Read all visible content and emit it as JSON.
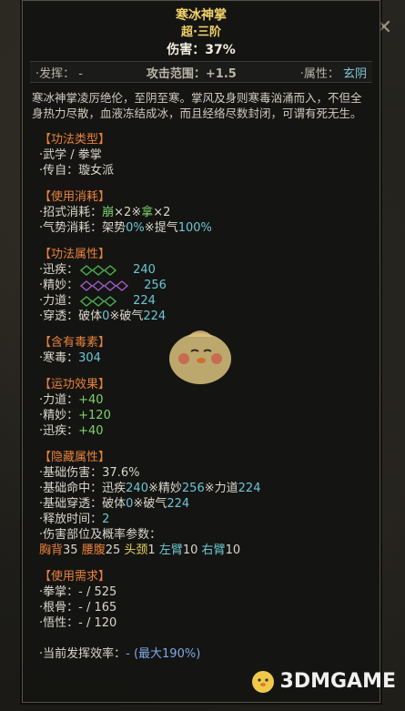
{
  "skill": {
    "name": "寒冰神掌",
    "tier": "超·三阶",
    "damage": "伤害：37%"
  },
  "meta": {
    "launch_label": "·发挥：",
    "launch_value": "-",
    "range_label": "攻击范围：",
    "range_value": "+1.5",
    "attr_label": "·属性：",
    "attr_value": "玄阴"
  },
  "description": "寒冰神掌凌厉绝伦，至阴至寒。掌风及身则寒毒汹涌而入，不但全身热力尽散，血液冻结成冰，而且经络尽数封闭，可谓有死无生。",
  "type_section": {
    "title": "【功法类型】",
    "lines": [
      "·武学 / 拳掌",
      "·传自：璇女派"
    ]
  },
  "cost_section": {
    "title": "【使用消耗】",
    "line1": {
      "label": "·招式消耗：",
      "a": "崩",
      "a_mult": "×2※",
      "b": "拿",
      "b_mult": "×2"
    },
    "line2": {
      "label": "·气势消耗：",
      "a": "架势",
      "a_val": "0%",
      "sep": "※",
      "b": "提气",
      "b_val": "100%"
    }
  },
  "attr_section": {
    "title": "【功法属性】",
    "speed": {
      "label": "·迅疾：",
      "value": "240"
    },
    "skill": {
      "label": "·精妙：",
      "value": "256"
    },
    "power": {
      "label": "·力道：",
      "value": "224"
    },
    "pierce": {
      "label": "·穿透：",
      "a": "破体",
      "a_val": "0",
      "sep": "※",
      "b": "破气",
      "b_val": "224"
    }
  },
  "poison_section": {
    "title": "【含有毒素】",
    "label": "·寒毒：",
    "value": "304"
  },
  "effect_section": {
    "title": "【运功效果】",
    "lines": [
      {
        "label": "·力道：",
        "value": "+40"
      },
      {
        "label": "·精妙：",
        "value": "+120"
      },
      {
        "label": "·迅疾：",
        "value": "+40"
      }
    ]
  },
  "hidden_section": {
    "title": "【隐藏属性】",
    "base_damage": {
      "label": "·基础伤害：",
      "value": "37.6%"
    },
    "base_hit": {
      "label": "·基础命中：",
      "a": "迅疾",
      "a_val": "240",
      "sep1": "※",
      "b": "精妙",
      "b_val": "256",
      "sep2": "※",
      "c": "力道",
      "c_val": "224"
    },
    "base_pierce": {
      "label": "·基础穿透：",
      "a": "破体",
      "a_val": "0",
      "sep": "※",
      "b": "破气",
      "b_val": "224"
    },
    "cast_time": {
      "label": "·释放时间：",
      "value": "2"
    },
    "parts_label": "·伤害部位及概率参数：",
    "parts": [
      {
        "name": "胸背",
        "value": "35"
      },
      {
        "name": "腰腹",
        "value": "25"
      },
      {
        "name": "头颈",
        "value": "1"
      },
      {
        "name": "左臂",
        "value": "10"
      },
      {
        "name": "右臂",
        "value": "10"
      }
    ]
  },
  "req_section": {
    "title": "【使用需求】",
    "lines": [
      {
        "label": "·拳掌：",
        "value": "- / 525"
      },
      {
        "label": "·根骨：",
        "value": "- / 165"
      },
      {
        "label": "·悟性：",
        "value": "- / 120"
      }
    ]
  },
  "footer": {
    "label": "·当前发挥效率：",
    "value": "- (最大190%)"
  },
  "watermark": {
    "text": "3DMGAME"
  },
  "colors": {
    "gold": "#f2d26b",
    "orange": "#e8823c",
    "green": "#7ed36b",
    "cyan": "#6cc6d3",
    "blue": "#7fa9e8",
    "diamond_green": "#4caf50",
    "diamond_purple": "#a05cc8"
  },
  "icons": {
    "close": "close-icon",
    "diamond": "diamond-icon",
    "mascot": "chick-mascot-icon"
  }
}
